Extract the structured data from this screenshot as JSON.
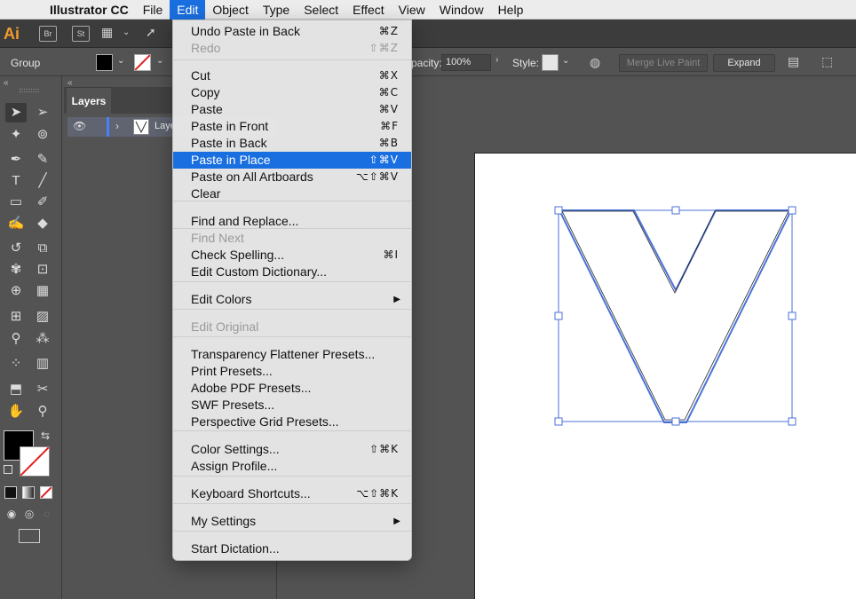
{
  "menubar": {
    "app": "Illustrator CC",
    "items": [
      "File",
      "Edit",
      "Object",
      "Type",
      "Select",
      "Effect",
      "View",
      "Window",
      "Help"
    ]
  },
  "appbar": {
    "logo": "Ai",
    "br": "Br",
    "st": "St"
  },
  "control_bar": {
    "selection": "Group",
    "opacity_label": "pacity:",
    "opacity_value": "100%",
    "style_label": "Style:",
    "merge_label": "Merge Live Paint",
    "expand_label": "Expand"
  },
  "layers": {
    "tab": "Layers",
    "layer_name": "Laye"
  },
  "edit_menu": {
    "items": [
      {
        "label": "Undo Paste in Back",
        "shortcut": "⌘Z"
      },
      {
        "label": "Redo",
        "shortcut": "⇧⌘Z",
        "disabled": true
      },
      {
        "label": "Cut",
        "shortcut": "⌘X"
      },
      {
        "label": "Copy",
        "shortcut": "⌘C"
      },
      {
        "label": "Paste",
        "shortcut": "⌘V"
      },
      {
        "label": "Paste in Front",
        "shortcut": "⌘F"
      },
      {
        "label": "Paste in Back",
        "shortcut": "⌘B"
      },
      {
        "label": "Paste in Place",
        "shortcut": "⇧⌘V",
        "highlighted": true
      },
      {
        "label": "Paste on All Artboards",
        "shortcut": "⌥⇧⌘V"
      },
      {
        "label": "Clear",
        "shortcut": ""
      },
      {
        "label": "Find and Replace...",
        "shortcut": ""
      },
      {
        "label": "Find Next",
        "shortcut": "",
        "disabled": true
      },
      {
        "label": "Check Spelling...",
        "shortcut": "⌘I"
      },
      {
        "label": "Edit Custom Dictionary...",
        "shortcut": ""
      },
      {
        "label": "Edit Colors",
        "shortcut": "",
        "submenu": true
      },
      {
        "label": "Edit Original",
        "shortcut": "",
        "disabled": true
      },
      {
        "label": "Transparency Flattener Presets...",
        "shortcut": ""
      },
      {
        "label": "Print Presets...",
        "shortcut": ""
      },
      {
        "label": "Adobe PDF Presets...",
        "shortcut": ""
      },
      {
        "label": "SWF Presets...",
        "shortcut": ""
      },
      {
        "label": "Perspective Grid Presets...",
        "shortcut": ""
      },
      {
        "label": "Color Settings...",
        "shortcut": "⇧⌘K"
      },
      {
        "label": "Assign Profile...",
        "shortcut": ""
      },
      {
        "label": "Keyboard Shortcuts...",
        "shortcut": "⌥⇧⌘K"
      },
      {
        "label": "My Settings",
        "shortcut": "",
        "submenu": true
      },
      {
        "label": "Start Dictation...",
        "shortcut": ""
      }
    ]
  },
  "colors": {
    "menu_highlight": "#1a6fe0",
    "ai_brand": "#f29b2b",
    "selection_blue": "#4a72d8"
  }
}
